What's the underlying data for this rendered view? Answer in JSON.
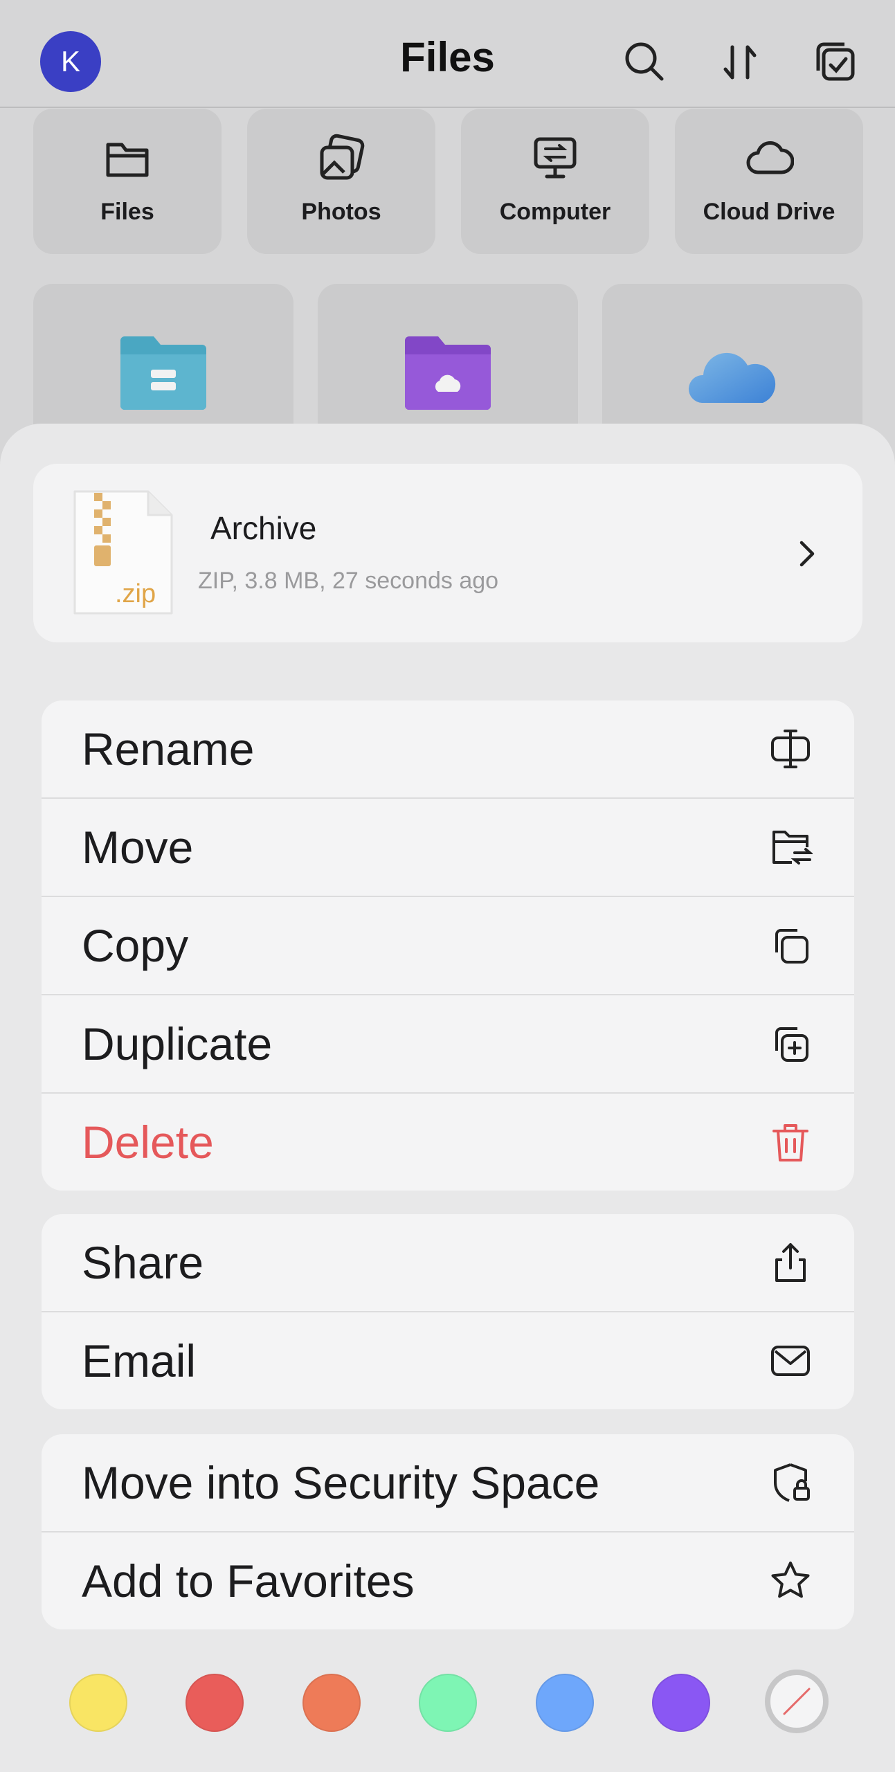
{
  "header": {
    "avatar_initial": "K",
    "title": "Files"
  },
  "categories": [
    {
      "label": "Files",
      "icon": "folder-outline-icon"
    },
    {
      "label": "Photos",
      "icon": "photos-icon"
    },
    {
      "label": "Computer",
      "icon": "computer-icon"
    },
    {
      "label": "Cloud Drive",
      "icon": "cloud-outline-icon"
    }
  ],
  "file": {
    "name": "Archive",
    "meta": "ZIP, 3.8 MB, 27 seconds ago",
    "ext": ".zip"
  },
  "menu_group1": [
    {
      "label": "Rename",
      "icon": "rename-icon"
    },
    {
      "label": "Move",
      "icon": "move-folder-icon"
    },
    {
      "label": "Copy",
      "icon": "copy-icon"
    },
    {
      "label": "Duplicate",
      "icon": "duplicate-icon"
    },
    {
      "label": "Delete",
      "icon": "trash-icon"
    }
  ],
  "menu_group2": [
    {
      "label": "Share",
      "icon": "share-icon"
    },
    {
      "label": "Email",
      "icon": "envelope-icon"
    }
  ],
  "menu_group3": [
    {
      "label": "Move into Security Space",
      "icon": "shield-lock-icon"
    },
    {
      "label": "Add to Favorites",
      "icon": "star-icon"
    }
  ],
  "tag_colors": [
    "#f9e564",
    "#e95d5a",
    "#ee7b58",
    "#7ef5b4",
    "#6ea7fb",
    "#8a57f3"
  ],
  "colors": {
    "accent": "#3a3fc4",
    "danger": "#e5585a"
  }
}
